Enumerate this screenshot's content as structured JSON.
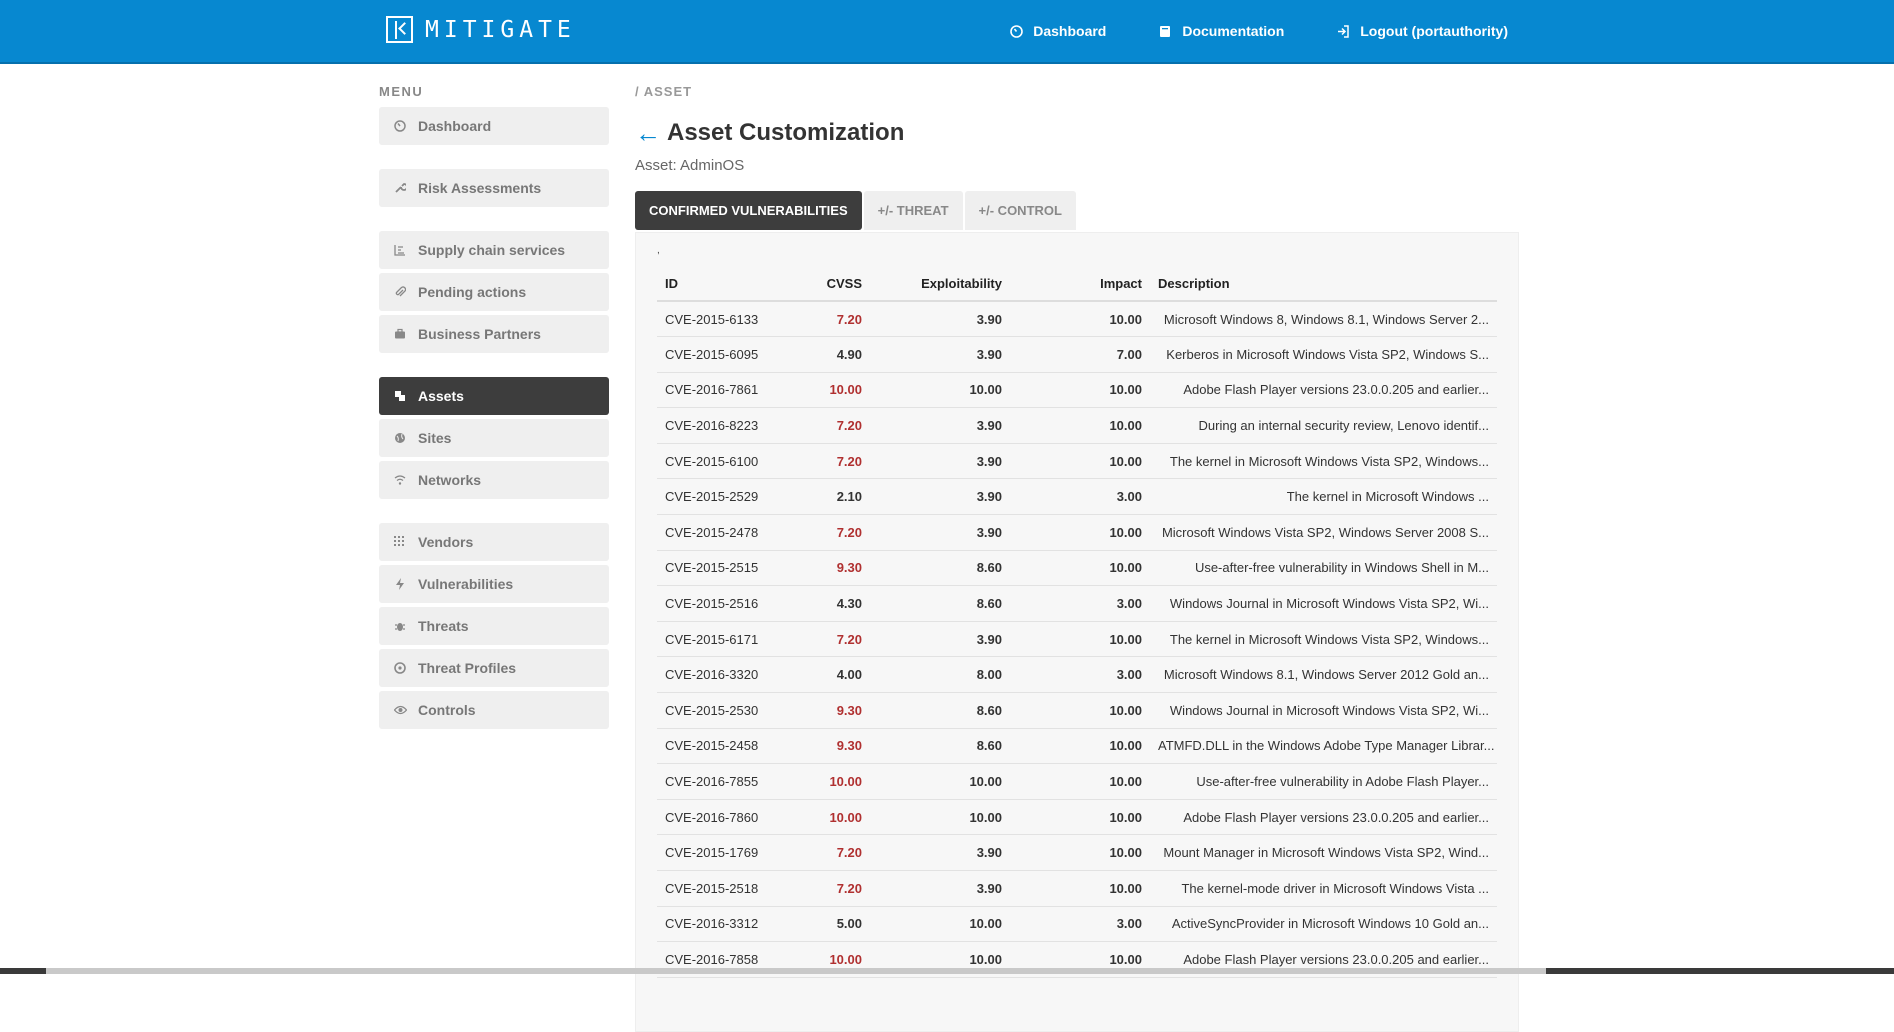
{
  "brand": {
    "name": "MITIGATE"
  },
  "topnav": [
    {
      "label": "Dashboard",
      "icon": "dashboard-icon"
    },
    {
      "label": "Documentation",
      "icon": "book-icon"
    },
    {
      "label": "Logout (portauthority)",
      "icon": "logout-icon"
    }
  ],
  "sidebar": {
    "title": "MENU",
    "items": [
      {
        "label": "Dashboard",
        "icon": "dashboard-icon"
      },
      {
        "label": "Risk Assessments",
        "icon": "wrench-icon"
      },
      {
        "label": "Supply chain services",
        "icon": "chain-services-icon"
      },
      {
        "label": "Pending actions",
        "icon": "paperclip-icon"
      },
      {
        "label": "Business Partners",
        "icon": "briefcase-icon"
      },
      {
        "label": "Assets",
        "icon": "assets-icon",
        "active": true
      },
      {
        "label": "Sites",
        "icon": "globe-icon"
      },
      {
        "label": "Networks",
        "icon": "wifi-icon"
      },
      {
        "label": "Vendors",
        "icon": "grid-icon"
      },
      {
        "label": "Vulnerabilities",
        "icon": "bolt-icon"
      },
      {
        "label": "Threats",
        "icon": "bug-icon"
      },
      {
        "label": "Threat Profiles",
        "icon": "aperture-icon"
      },
      {
        "label": "Controls",
        "icon": "eye-icon"
      }
    ]
  },
  "main": {
    "breadcrumb": "/ ASSET",
    "title": "Asset Customization",
    "back": "←",
    "subtitle": "Asset: AdminOS",
    "tabs": [
      "CONFIRMED VULNERABILITIES",
      "+/- THREAT",
      "+/- CONTROL"
    ],
    "stray_mark": ",",
    "table": {
      "headers": [
        "ID",
        "CVSS",
        "Exploitability",
        "Impact",
        "Description"
      ],
      "rows": [
        {
          "id": "CVE-2015-6133",
          "cvss": "7.20",
          "exp": "3.90",
          "imp": "10.00",
          "desc": "Microsoft Windows 8, Windows 8.1, Windows Server 2...",
          "red": true
        },
        {
          "id": "CVE-2015-6095",
          "cvss": "4.90",
          "exp": "3.90",
          "imp": "7.00",
          "desc": "Kerberos in Microsoft Windows Vista SP2, Windows S...",
          "red": false
        },
        {
          "id": "CVE-2016-7861",
          "cvss": "10.00",
          "exp": "10.00",
          "imp": "10.00",
          "desc": "Adobe Flash Player versions 23.0.0.205 and earlier...",
          "red": true
        },
        {
          "id": "CVE-2016-8223",
          "cvss": "7.20",
          "exp": "3.90",
          "imp": "10.00",
          "desc": "During an internal security review, Lenovo identif...",
          "red": true
        },
        {
          "id": "CVE-2015-6100",
          "cvss": "7.20",
          "exp": "3.90",
          "imp": "10.00",
          "desc": "The kernel in Microsoft Windows Vista SP2, Windows...",
          "red": true
        },
        {
          "id": "CVE-2015-2529",
          "cvss": "2.10",
          "exp": "3.90",
          "imp": "3.00",
          "desc": "The kernel in Microsoft Windows ...",
          "red": false
        },
        {
          "id": "CVE-2015-2478",
          "cvss": "7.20",
          "exp": "3.90",
          "imp": "10.00",
          "desc": "Microsoft Windows Vista SP2, Windows Server 2008 S...",
          "red": true
        },
        {
          "id": "CVE-2015-2515",
          "cvss": "9.30",
          "exp": "8.60",
          "imp": "10.00",
          "desc": "Use-after-free vulnerability in Windows Shell in M...",
          "red": true
        },
        {
          "id": "CVE-2015-2516",
          "cvss": "4.30",
          "exp": "8.60",
          "imp": "3.00",
          "desc": "Windows Journal in Microsoft Windows Vista SP2, Wi...",
          "red": false
        },
        {
          "id": "CVE-2015-6171",
          "cvss": "7.20",
          "exp": "3.90",
          "imp": "10.00",
          "desc": "The kernel in Microsoft Windows Vista SP2, Windows...",
          "red": true
        },
        {
          "id": "CVE-2016-3320",
          "cvss": "4.00",
          "exp": "8.00",
          "imp": "3.00",
          "desc": "Microsoft Windows 8.1, Windows Server 2012 Gold an...",
          "red": false
        },
        {
          "id": "CVE-2015-2530",
          "cvss": "9.30",
          "exp": "8.60",
          "imp": "10.00",
          "desc": "Windows Journal in Microsoft Windows Vista SP2, Wi...",
          "red": true
        },
        {
          "id": "CVE-2015-2458",
          "cvss": "9.30",
          "exp": "8.60",
          "imp": "10.00",
          "desc": "ATMFD.DLL in the Windows Adobe Type Manager Librar...",
          "red": true
        },
        {
          "id": "CVE-2016-7855",
          "cvss": "10.00",
          "exp": "10.00",
          "imp": "10.00",
          "desc": "Use-after-free vulnerability in Adobe Flash Player...",
          "red": true
        },
        {
          "id": "CVE-2016-7860",
          "cvss": "10.00",
          "exp": "10.00",
          "imp": "10.00",
          "desc": "Adobe Flash Player versions 23.0.0.205 and earlier...",
          "red": true
        },
        {
          "id": "CVE-2015-1769",
          "cvss": "7.20",
          "exp": "3.90",
          "imp": "10.00",
          "desc": "Mount Manager in Microsoft Windows Vista SP2, Wind...",
          "red": true
        },
        {
          "id": "CVE-2015-2518",
          "cvss": "7.20",
          "exp": "3.90",
          "imp": "10.00",
          "desc": "The kernel-mode driver in Microsoft Windows Vista ...",
          "red": true
        },
        {
          "id": "CVE-2016-3312",
          "cvss": "5.00",
          "exp": "10.00",
          "imp": "3.00",
          "desc": "ActiveSyncProvider in Microsoft Windows 10 Gold an...",
          "red": false
        },
        {
          "id": "CVE-2016-7858",
          "cvss": "10.00",
          "exp": "10.00",
          "imp": "10.00",
          "desc": "Adobe Flash Player versions 23.0.0.205 and earlier...",
          "red": true
        }
      ]
    }
  },
  "colors": {
    "topbar": "#0788d0",
    "active": "#3d3d3d",
    "danger": "#b03030"
  }
}
